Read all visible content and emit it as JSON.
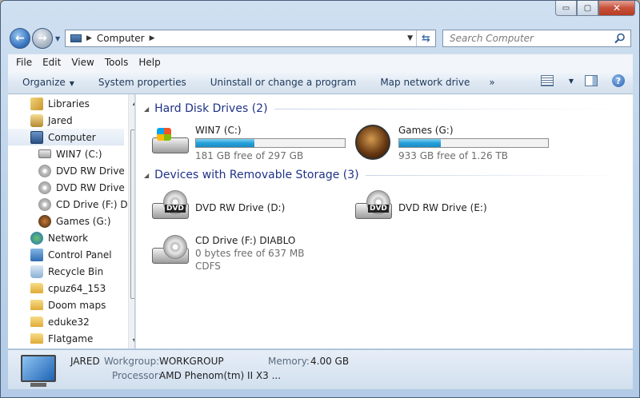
{
  "window": {
    "caption": {
      "minimize": "▭",
      "maximize": "▢",
      "close": "✕"
    }
  },
  "address": {
    "crumb": "Computer",
    "search_placeholder": "Search Computer"
  },
  "menubar": [
    "File",
    "Edit",
    "View",
    "Tools",
    "Help"
  ],
  "commandbar": {
    "organize": "Organize",
    "system_properties": "System properties",
    "uninstall": "Uninstall or change a program",
    "map_drive": "Map network drive",
    "more": "»",
    "help": "?"
  },
  "navpane": [
    {
      "label": "Libraries",
      "icon": "libraries-icon"
    },
    {
      "label": "Jared",
      "icon": "user-folder-icon"
    },
    {
      "label": "Computer",
      "icon": "computer-icon",
      "selected": true
    },
    {
      "label": "WIN7 (C:)",
      "icon": "hard-drive-icon"
    },
    {
      "label": "DVD RW Drive (",
      "icon": "dvd-drive-icon"
    },
    {
      "label": "DVD RW Drive (",
      "icon": "dvd-drive-icon"
    },
    {
      "label": "CD Drive (F:) DI",
      "icon": "cd-drive-icon"
    },
    {
      "label": "Games (G:)",
      "icon": "games-drive-icon"
    },
    {
      "label": "Network",
      "icon": "network-icon"
    },
    {
      "label": "Control Panel",
      "icon": "control-panel-icon"
    },
    {
      "label": "Recycle Bin",
      "icon": "recycle-bin-icon"
    },
    {
      "label": "cpuz64_153",
      "icon": "folder-icon"
    },
    {
      "label": "Doom maps",
      "icon": "folder-icon"
    },
    {
      "label": "eduke32",
      "icon": "folder-icon"
    },
    {
      "label": "Flatgame",
      "icon": "folder-icon"
    }
  ],
  "content": {
    "groups": [
      {
        "title": "Hard Disk Drives (2)"
      },
      {
        "title": "Devices with Removable Storage (3)"
      }
    ],
    "drives": [
      {
        "name": "WIN7 (C:)",
        "free": "181 GB free of 297 GB",
        "used_fraction": 0.39
      },
      {
        "name": "Games (G:)",
        "free": "933 GB free of 1.26 TB",
        "used_fraction": 0.28
      }
    ],
    "removable": [
      {
        "name": "DVD RW Drive (D:)",
        "badge": "DVD"
      },
      {
        "name": "DVD RW Drive (E:)",
        "badge": "DVD"
      },
      {
        "name": "CD Drive (F:) DIABLO",
        "free": "0 bytes free of 637 MB",
        "fs": "CDFS"
      }
    ]
  },
  "details": {
    "name": "JARED",
    "workgroup_label": "Workgroup:",
    "workgroup": "WORKGROUP",
    "memory_label": "Memory:",
    "memory": "4.00 GB",
    "processor_label": "Processor:",
    "processor": "AMD Phenom(tm) II X3 ..."
  }
}
